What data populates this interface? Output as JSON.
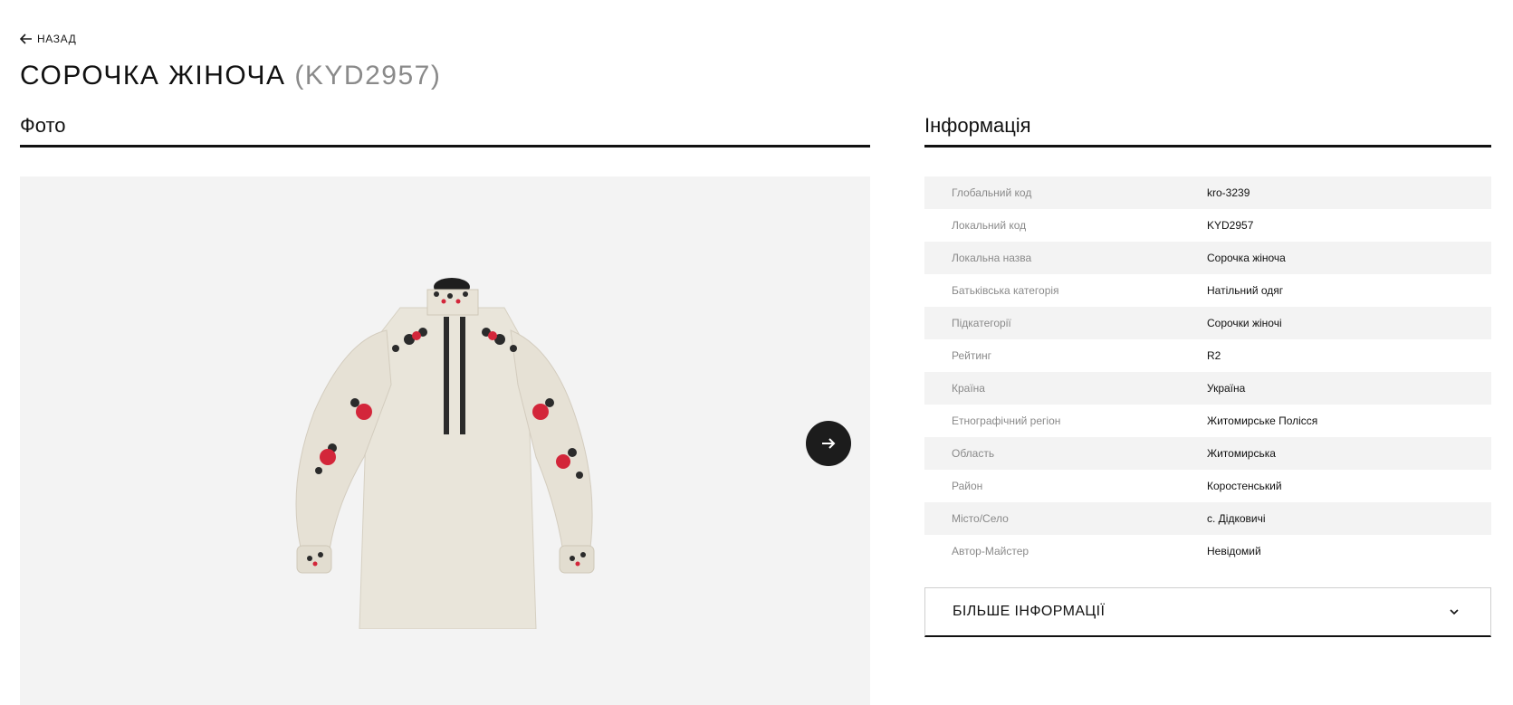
{
  "nav": {
    "back_label": "НАЗАД"
  },
  "header": {
    "title": "СОРОЧКА ЖІНОЧА",
    "code": "(KYD2957)"
  },
  "photo_section": {
    "heading": "Фото"
  },
  "info_section": {
    "heading": "Інформація",
    "rows": [
      {
        "label": "Глобальний код",
        "value": "kro-3239"
      },
      {
        "label": "Локальний код",
        "value": "KYD2957"
      },
      {
        "label": "Локальна назва",
        "value": "Сорочка жіноча"
      },
      {
        "label": "Батьківська категорія",
        "value": "Натільний одяг"
      },
      {
        "label": "Підкатегорії",
        "value": "Сорочки жіночі"
      },
      {
        "label": "Рейтинг",
        "value": "R2"
      },
      {
        "label": "Країна",
        "value": "Україна"
      },
      {
        "label": "Етнографічний регіон",
        "value": "Житомирське Полісся"
      },
      {
        "label": "Область",
        "value": "Житомирська"
      },
      {
        "label": "Район",
        "value": "Коростенський"
      },
      {
        "label": "Місто/Село",
        "value": "с. Дідковичі"
      },
      {
        "label": "Автор-Майстер",
        "value": "Невідомий"
      }
    ],
    "more_label": "БІЛЬШЕ ІНФОРМАЦІЇ"
  },
  "icons": [
    "arrow-left-icon",
    "arrow-right-icon",
    "chevron-down-icon"
  ],
  "colors": {
    "accent": "#1c1c1c",
    "stripe": "#f3f3f3",
    "muted_text": "#8a8a8a",
    "embroidery_red": "#d3263a"
  }
}
